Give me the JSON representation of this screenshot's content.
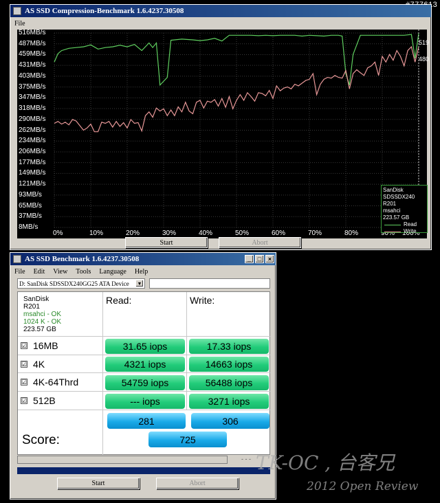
{
  "top_watermark": "#777613",
  "compression_window": {
    "title": "AS SSD Compression-Benchmark 1.6.4237.30508",
    "menu": [
      "File"
    ],
    "start_label": "Start",
    "abort_label": "Abort",
    "legend": {
      "device": "SanDisk SDSSDX240",
      "firmware": "R201",
      "driver": "msahci",
      "size": "223.57 GB",
      "read_label": "Read",
      "write_label": "Write"
    },
    "end_values": {
      "read": "519",
      "write": "480"
    }
  },
  "chart_data": {
    "type": "line",
    "y_ticks": [
      "516MB/s",
      "487MB/s",
      "459MB/s",
      "431MB/s",
      "403MB/s",
      "375MB/s",
      "347MB/s",
      "318MB/s",
      "290MB/s",
      "262MB/s",
      "234MB/s",
      "206MB/s",
      "177MB/s",
      "149MB/s",
      "121MB/s",
      "93MB/s",
      "65MB/s",
      "37MB/s",
      "8MB/s"
    ],
    "x_ticks": [
      "0%",
      "10%",
      "20%",
      "30%",
      "40%",
      "50%",
      "60%",
      "70%",
      "80%",
      "90%",
      "100%"
    ],
    "ylim": [
      8,
      516
    ],
    "xlim": [
      0,
      100
    ],
    "grid": true,
    "legend_position": "bottom-right",
    "series": [
      {
        "name": "Read",
        "color": "#5fcf5f",
        "x": [
          0,
          1,
          2,
          4,
          6,
          8,
          10,
          12,
          14,
          16,
          18,
          20,
          22,
          24,
          26,
          27,
          28,
          29,
          31,
          32,
          35,
          38,
          40,
          42,
          44,
          46,
          48,
          50,
          52,
          54,
          56,
          58,
          60,
          62,
          64,
          66,
          68,
          70,
          72,
          74,
          76,
          78,
          79,
          80,
          81,
          82,
          84,
          86,
          88,
          90,
          92,
          94,
          96,
          98,
          99,
          100
        ],
        "y": [
          440,
          462,
          470,
          476,
          478,
          480,
          485,
          474,
          478,
          480,
          484,
          480,
          486,
          470,
          490,
          478,
          490,
          380,
          400,
          497,
          500,
          498,
          496,
          498,
          502,
          495,
          510,
          510,
          510,
          510,
          509,
          510,
          509,
          510,
          510,
          510,
          508,
          510,
          509,
          508,
          510,
          510,
          508,
          410,
          380,
          460,
          510,
          510,
          510,
          510,
          510,
          510,
          510,
          512,
          450,
          515
        ]
      },
      {
        "name": "Write",
        "color": "#e89898",
        "x": [
          0,
          1,
          2,
          3,
          4,
          5,
          6,
          8,
          9,
          10,
          11,
          12,
          13,
          14,
          15,
          16,
          17,
          18,
          19,
          20,
          21,
          22,
          23,
          24,
          25,
          26,
          27,
          28,
          29,
          30,
          31,
          32,
          33,
          34,
          35,
          36,
          37,
          38,
          39,
          40,
          41,
          42,
          43,
          44,
          45,
          46,
          47,
          48,
          49,
          50,
          51,
          52,
          53,
          54,
          55,
          56,
          57,
          58,
          59,
          60,
          61,
          62,
          63,
          64,
          65,
          66,
          67,
          68,
          69,
          70,
          71,
          72,
          73,
          74,
          75,
          76,
          77,
          78,
          79,
          80,
          81,
          82,
          83,
          84,
          85,
          86,
          87,
          88,
          89,
          90,
          91,
          92,
          93,
          94,
          95,
          96,
          97,
          98,
          99,
          100
        ],
        "y": [
          280,
          285,
          278,
          283,
          276,
          290,
          286,
          262,
          268,
          278,
          258,
          258,
          283,
          280,
          285,
          270,
          285,
          272,
          282,
          268,
          290,
          280,
          282,
          260,
          300,
          310,
          296,
          320,
          312,
          318,
          300,
          315,
          300,
          323,
          310,
          335,
          312,
          305,
          335,
          340,
          320,
          338,
          335,
          342,
          325,
          345,
          322,
          350,
          318,
          340,
          355,
          340,
          360,
          350,
          338,
          360,
          358,
          352,
          366,
          345,
          378,
          365,
          372,
          375,
          370,
          382,
          378,
          385,
          392,
          395,
          410,
          355,
          382,
          395,
          400,
          398,
          405,
          400,
          398,
          418,
          370,
          410,
          420,
          412,
          405,
          425,
          430,
          440,
          405,
          455,
          440,
          460,
          445,
          470,
          455,
          430,
          470,
          480,
          440,
          480
        ]
      }
    ]
  },
  "benchmark_window": {
    "title": "AS SSD Benchmark 1.6.4237.30508",
    "menu": [
      "File",
      "Edit",
      "View",
      "Tools",
      "Language",
      "Help"
    ],
    "device_select": "D: SanDisk SDSSDX240GG25 ATA Device",
    "drive_info": {
      "brand": "SanDisk",
      "firmware": "R201",
      "driver_status": "msahci - OK",
      "align_status": "1024 K - OK",
      "size": "223.57 GB"
    },
    "read_header": "Read:",
    "write_header": "Write:",
    "score_label": "Score:",
    "rows": [
      {
        "label": "16MB",
        "checked": "☑",
        "read": "31.65 iops",
        "write": "17.33 iops"
      },
      {
        "label": "4K",
        "checked": "☑",
        "read": "4321 iops",
        "write": "14663 iops"
      },
      {
        "label": "4K-64Thrd",
        "checked": "☑",
        "read": "54759 iops",
        "write": "56488 iops"
      },
      {
        "label": "512B",
        "checked": "☑",
        "read": "--- iops",
        "write": "3271 iops"
      }
    ],
    "score": {
      "read": "281",
      "write": "306",
      "total": "725"
    },
    "progress_time": "- - -",
    "start_label": "Start",
    "abort_label": "Abort"
  },
  "watermark": {
    "line1": "TK-OC , 台客兄",
    "line2": "2012 Open Review"
  }
}
